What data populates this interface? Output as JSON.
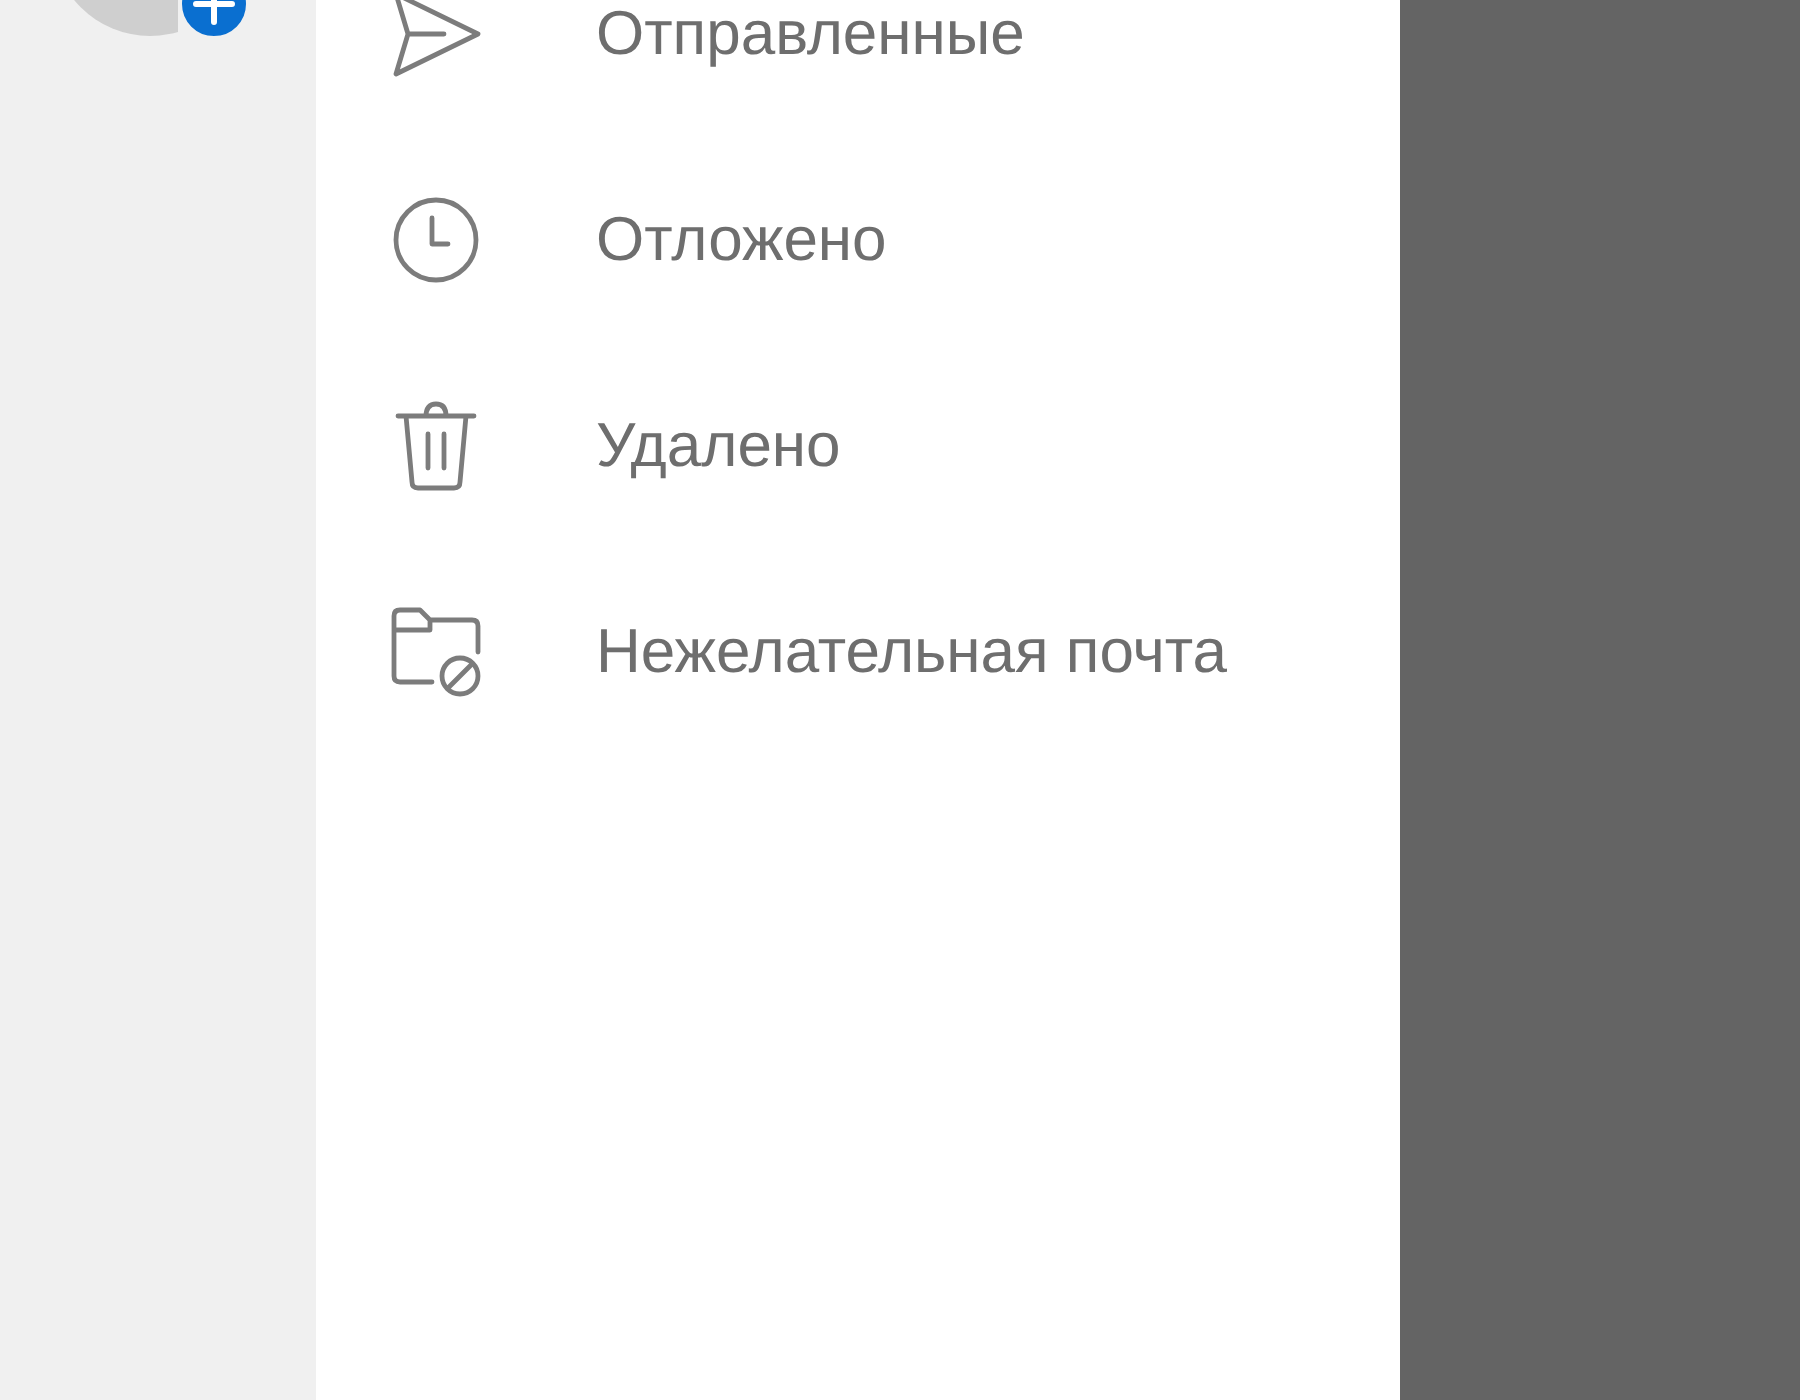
{
  "folders": [
    {
      "kind": "sent",
      "label": "Отправленные"
    },
    {
      "kind": "snoozed",
      "label": "Отложено"
    },
    {
      "kind": "deleted",
      "label": "Удалено"
    },
    {
      "kind": "junk",
      "label": "Нежелательная почта"
    }
  ]
}
